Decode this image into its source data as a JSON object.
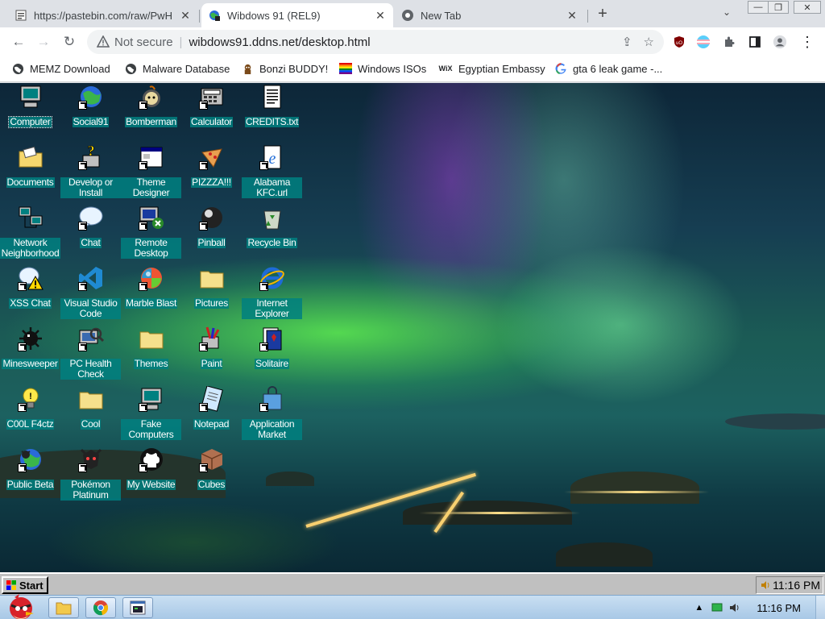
{
  "browser": {
    "tabs": [
      {
        "title": "https://pastebin.com/raw/PwH",
        "close": "✕"
      },
      {
        "title": "Wibdows 91 (REL9)",
        "close": "✕",
        "active": true
      },
      {
        "title": "New Tab",
        "close": "✕"
      }
    ],
    "new_tab": "+",
    "tab_search": "⌄",
    "window_controls": {
      "minimize": "—",
      "restore": "❐",
      "close": "✕"
    },
    "nav": {
      "back": "←",
      "forward": "→",
      "reload": "↻"
    },
    "security_label": "Not secure",
    "url": "wibdows91.ddns.net/desktop.html",
    "omnibox_icons": {
      "share": "⇪",
      "star": "☆"
    },
    "menu": "⋮"
  },
  "bookmarks": [
    {
      "label": "MEMZ Download",
      "icon": "globe-icon"
    },
    {
      "label": "Malware Database",
      "icon": "globe-icon"
    },
    {
      "label": "Bonzi BUDDY!",
      "icon": "bonzi-icon"
    },
    {
      "label": "Windows ISOs",
      "icon": "rainbow-icon"
    },
    {
      "label": "Egyptian Embassy",
      "icon": "wix-icon"
    },
    {
      "label": "gta 6 leak game -...",
      "icon": "google-icon"
    }
  ],
  "desktop_icons": [
    {
      "label": "Computer",
      "icon": "computer",
      "shortcut": false
    },
    {
      "label": "Social91",
      "icon": "globe",
      "shortcut": true
    },
    {
      "label": "Bomberman",
      "icon": "bomber",
      "shortcut": true
    },
    {
      "label": "Calculator",
      "icon": "calculator",
      "shortcut": true
    },
    {
      "label": "CREDITS.txt",
      "icon": "text",
      "shortcut": false
    },
    {
      "label": "Documents",
      "icon": "folder-docs",
      "shortcut": false
    },
    {
      "label": "Develop or Install",
      "icon": "help",
      "shortcut": true
    },
    {
      "label": "Theme Designer",
      "icon": "window",
      "shortcut": true
    },
    {
      "label": "PIZZZA!!!",
      "icon": "pizza",
      "shortcut": true
    },
    {
      "label": "Alabama KFC.url",
      "icon": "ie-doc",
      "shortcut": true
    },
    {
      "label": "Network Neighborhood",
      "icon": "network",
      "shortcut": false
    },
    {
      "label": "Chat",
      "icon": "bubble",
      "shortcut": true
    },
    {
      "label": "Remote Desktop",
      "icon": "remote",
      "shortcut": true
    },
    {
      "label": "Pinball",
      "icon": "ball",
      "shortcut": true
    },
    {
      "label": "Recycle Bin",
      "icon": "recycle",
      "shortcut": false
    },
    {
      "label": "XSS Chat",
      "icon": "bubble-warn",
      "shortcut": true
    },
    {
      "label": "Visual Studio Code",
      "icon": "vscode",
      "shortcut": true
    },
    {
      "label": "Marble Blast",
      "icon": "marble",
      "shortcut": true
    },
    {
      "label": "Pictures",
      "icon": "folder",
      "shortcut": false
    },
    {
      "label": "Internet Explorer",
      "icon": "ie",
      "shortcut": true
    },
    {
      "label": "Minesweeper",
      "icon": "mine",
      "shortcut": true
    },
    {
      "label": "PC Health Check",
      "icon": "health",
      "shortcut": true
    },
    {
      "label": "Themes",
      "icon": "folder",
      "shortcut": false
    },
    {
      "label": "Paint",
      "icon": "paint",
      "shortcut": true
    },
    {
      "label": "Solitaire",
      "icon": "cards",
      "shortcut": true
    },
    {
      "label": "C00L F4ctz",
      "icon": "bulb",
      "shortcut": true
    },
    {
      "label": "Cool",
      "icon": "folder",
      "shortcut": false
    },
    {
      "label": "Fake Computers",
      "icon": "computer",
      "shortcut": true
    },
    {
      "label": "Notepad",
      "icon": "notepad",
      "shortcut": true
    },
    {
      "label": "Application Market",
      "icon": "bag",
      "shortcut": true
    },
    {
      "label": "Public Beta",
      "icon": "globe-bug",
      "shortcut": true
    },
    {
      "label": "Pokémon Platinum",
      "icon": "pokemon",
      "shortcut": true
    },
    {
      "label": "My Website",
      "icon": "github",
      "shortcut": true
    },
    {
      "label": "Cubes",
      "icon": "cube",
      "shortcut": true
    }
  ],
  "taskbar91": {
    "start_label": "Start",
    "clock": "11:16 PM"
  },
  "taskbar7": {
    "clock": "11:16 PM",
    "tray_arrow": "▲"
  }
}
